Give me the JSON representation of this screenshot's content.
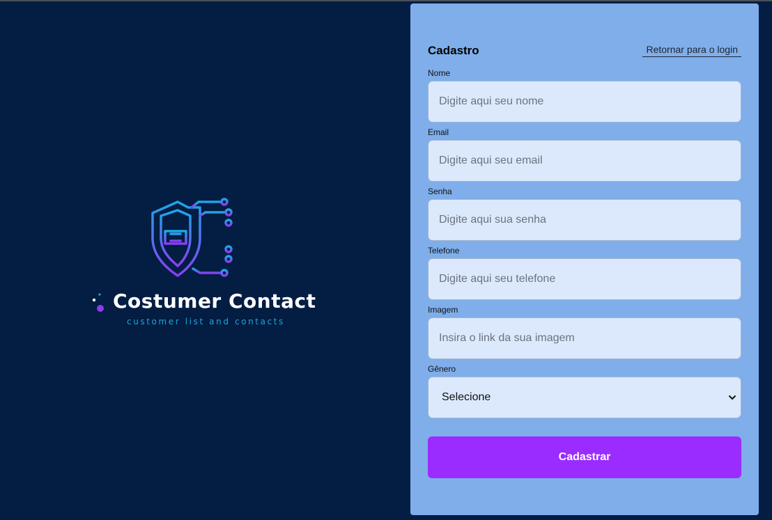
{
  "brand": {
    "name": "Costumer Contact",
    "tagline": "customer list and contacts",
    "icon": "shield-circuit-icon",
    "colors": {
      "gradient_start": "#1ea7e6",
      "gradient_end": "#8b3cf2"
    }
  },
  "form": {
    "title": "Cadastro",
    "back_link": "Retornar para o login",
    "fields": {
      "name": {
        "label": "Nome",
        "placeholder": "Digite aqui seu nome"
      },
      "email": {
        "label": "Email",
        "placeholder": "Digite aqui seu email"
      },
      "password": {
        "label": "Senha",
        "placeholder": "Digite aqui sua senha"
      },
      "phone": {
        "label": "Telefone",
        "placeholder": "Digite aqui seu telefone"
      },
      "image": {
        "label": "Imagem",
        "placeholder": "Insira o link da sua imagem"
      },
      "gender": {
        "label": "Gênero",
        "selected": "Selecione"
      }
    },
    "submit_label": "Cadastrar"
  },
  "colors": {
    "background": "#031d43",
    "panel": "#7faeea",
    "input_bg": "#dce9fd",
    "button": "#9b2cff"
  }
}
